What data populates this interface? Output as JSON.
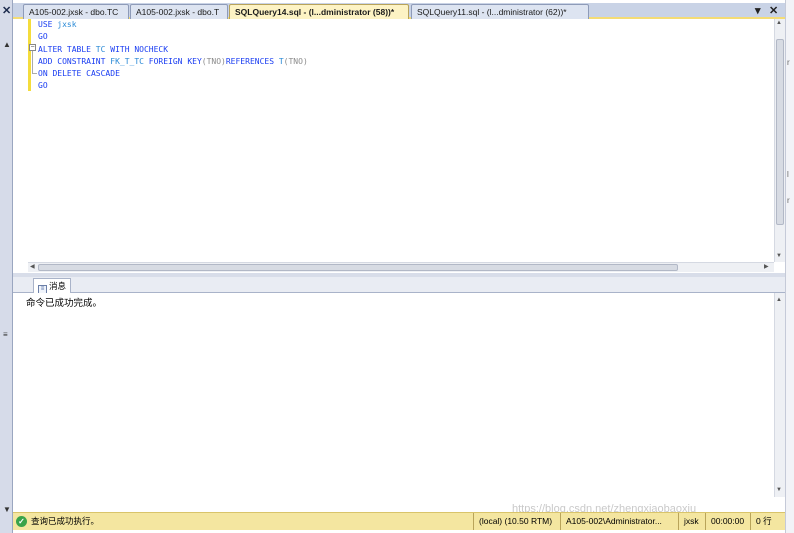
{
  "tabs": [
    {
      "label": "A105-002.jxsk - dbo.TC"
    },
    {
      "label": "A105-002.jxsk - dbo.T"
    },
    {
      "label": "SQLQuery14.sql - (l...dministrator (58))*"
    },
    {
      "label": "SQLQuery11.sql - (l...dministrator (62))*"
    }
  ],
  "tab_controls": {
    "dropdown": "▾",
    "close": "✕"
  },
  "editor": {
    "lines": [
      [
        {
          "t": "USE ",
          "c": "kw"
        },
        {
          "t": "jxsk",
          "c": "id"
        }
      ],
      [
        {
          "t": "GO",
          "c": "kw"
        }
      ],
      [
        {
          "t": "ALTER TABLE ",
          "c": "kw"
        },
        {
          "t": "TC ",
          "c": "id"
        },
        {
          "t": "WITH NOCHECK",
          "c": "kw"
        }
      ],
      [
        {
          "t": "ADD CONSTRAINT ",
          "c": "kw"
        },
        {
          "t": "FK_T_TC ",
          "c": "id"
        },
        {
          "t": "FOREIGN KEY",
          "c": "kw"
        },
        {
          "t": "(TNO)",
          "c": "gray"
        },
        {
          "t": "REFERENCES ",
          "c": "kw"
        },
        {
          "t": "T",
          "c": "id"
        },
        {
          "t": "(TNO)",
          "c": "gray"
        }
      ],
      [
        {
          "t": "ON DELETE CASCADE",
          "c": "kw"
        }
      ],
      [
        {
          "t": "GO",
          "c": "kw"
        }
      ]
    ]
  },
  "results": {
    "tab_label": "消息",
    "message": "命令已成功完成。"
  },
  "status": {
    "text": "查询已成功执行。",
    "server": "(local) (10.50 RTM)",
    "user": "A105-002\\Administrator...",
    "database": "jxsk",
    "elapsed": "00:00:00",
    "rows": "0 行"
  },
  "watermark": "https://blog.csdn.net/zhengxiaobaoxiu",
  "colors": {
    "keyword": "#1a3df2",
    "identifier": "#2a8ad6",
    "status_bar": "#f4e6a0",
    "active_tab": "#fdf3c4"
  }
}
